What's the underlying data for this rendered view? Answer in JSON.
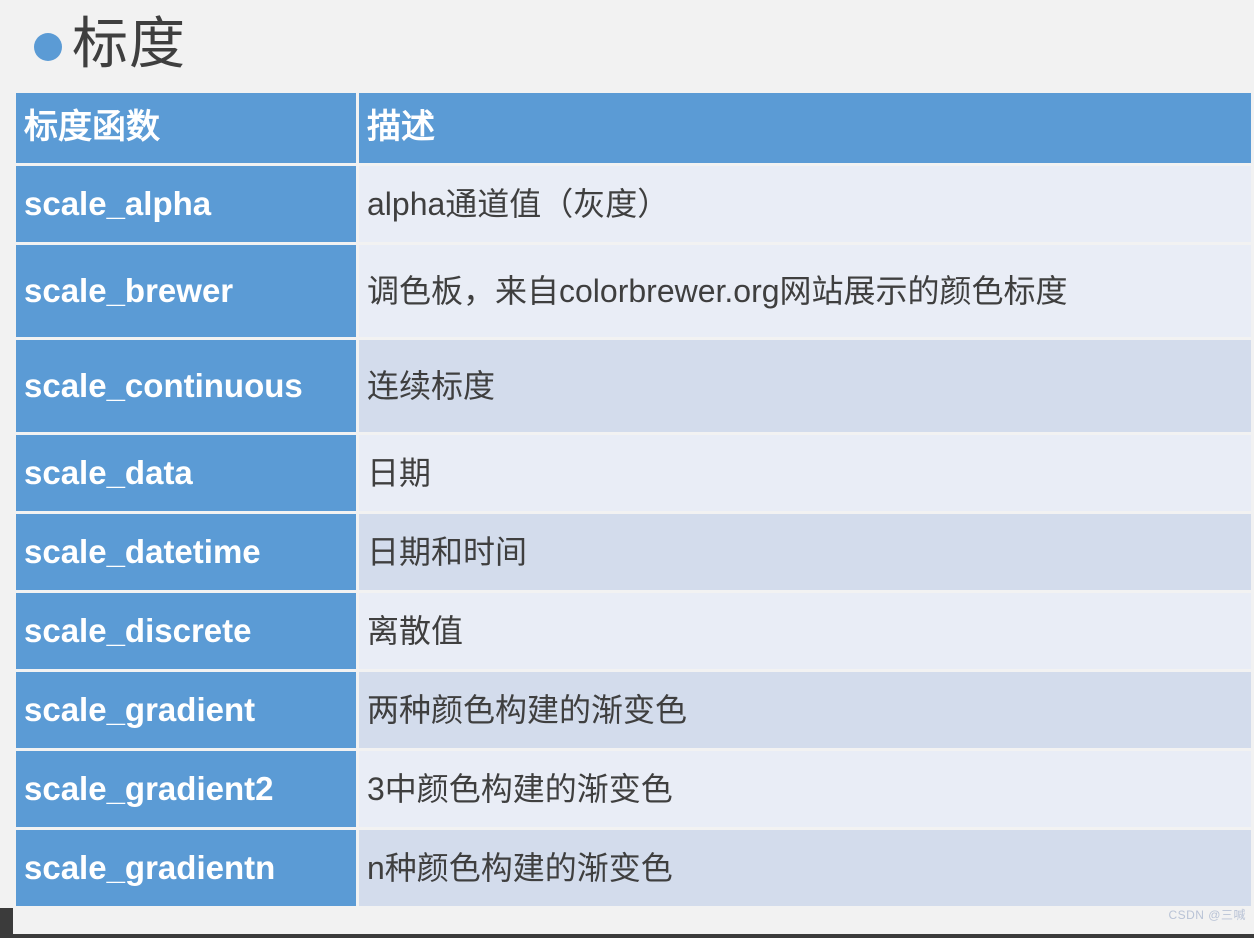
{
  "slide": {
    "title": "标度",
    "bullet_icon": "filled-circle-bullet-icon",
    "accent_color": "#5b9bd5",
    "background_color": "#f2f2f2",
    "text_color": "#3f3f3f",
    "band_light_color": "#e9edf6",
    "band_dark_color": "#d3dcec"
  },
  "table": {
    "columns": [
      "标度函数",
      "描述"
    ],
    "rows": [
      {
        "func": "scale_alpha",
        "desc": "alpha通道值（灰度）",
        "band": "light",
        "lines": 1
      },
      {
        "func": "scale_brewer",
        "desc": "调色板，来自colorbrewer.org网站展示的颜色标度",
        "band": "light",
        "lines": 2
      },
      {
        "func": "scale_continuous",
        "desc": "连续标度",
        "band": "dark",
        "lines": 2
      },
      {
        "func": "scale_data",
        "desc": "日期",
        "band": "light",
        "lines": 1
      },
      {
        "func": "scale_datetime",
        "desc": "日期和时间",
        "band": "dark",
        "lines": 1
      },
      {
        "func": "scale_discrete",
        "desc": "离散值",
        "band": "light",
        "lines": 1
      },
      {
        "func": "scale_gradient",
        "desc": "两种颜色构建的渐变色",
        "band": "dark",
        "lines": 1
      },
      {
        "func": "scale_gradient2",
        "desc": "3中颜色构建的渐变色",
        "band": "light",
        "lines": 1
      },
      {
        "func": "scale_gradientn",
        "desc": "n种颜色构建的渐变色",
        "band": "dark",
        "lines": 1
      }
    ]
  },
  "watermark": {
    "text": "CSDN @三喊"
  }
}
